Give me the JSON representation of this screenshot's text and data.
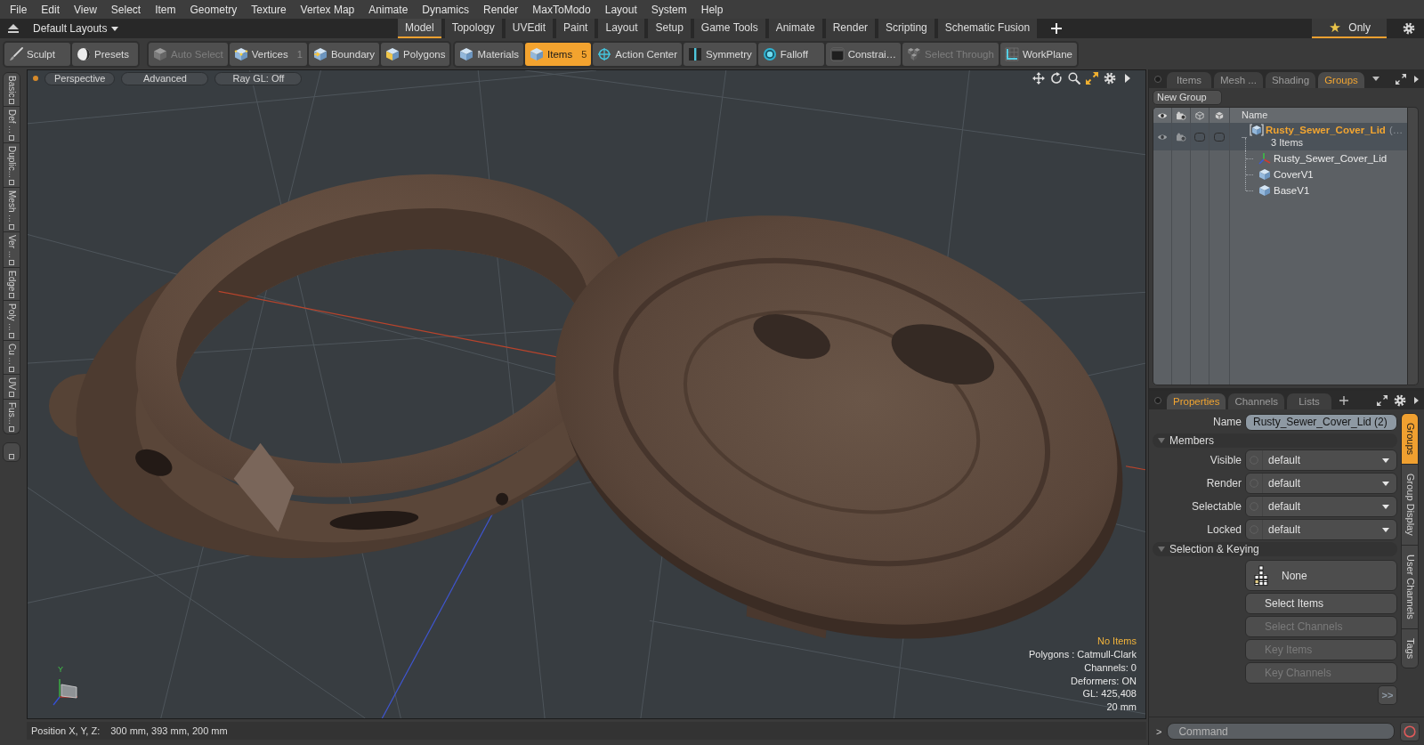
{
  "menu_bar": [
    "File",
    "Edit",
    "View",
    "Select",
    "Item",
    "Geometry",
    "Texture",
    "Vertex Map",
    "Animate",
    "Dynamics",
    "Render",
    "MaxToModo",
    "Layout",
    "System",
    "Help"
  ],
  "layout_bar": {
    "layout_menu": "Default Layouts",
    "tabs": [
      {
        "label": "Model",
        "selected": true
      },
      {
        "label": "Topology",
        "selected": false
      },
      {
        "label": "UVEdit",
        "selected": false
      },
      {
        "label": "Paint",
        "selected": false
      },
      {
        "label": "Layout",
        "selected": false
      },
      {
        "label": "Setup",
        "selected": false
      },
      {
        "label": "Game Tools",
        "selected": false
      },
      {
        "label": "Animate",
        "selected": false
      },
      {
        "label": "Render",
        "selected": false
      },
      {
        "label": "Scripting",
        "selected": false
      },
      {
        "label": "Schematic Fusion",
        "selected": false
      }
    ],
    "only_button": {
      "label": "Only",
      "on": true
    }
  },
  "toolbar": [
    {
      "items": [
        {
          "label": "Sculpt",
          "selected": false,
          "disabled": false
        },
        {
          "label": "Presets",
          "selected": false,
          "disabled": false
        }
      ]
    },
    {
      "items": [
        {
          "label": "Auto Select",
          "selected": false,
          "disabled": true
        },
        {
          "label": "Vertices",
          "count": "1",
          "selected": false,
          "disabled": false
        },
        {
          "label": "Boundary",
          "selected": false,
          "disabled": false
        },
        {
          "label": "Polygons",
          "selected": false,
          "disabled": false
        }
      ]
    },
    {
      "items": [
        {
          "label": "Materials",
          "selected": false,
          "disabled": false
        },
        {
          "label": "Items",
          "count": "5",
          "selected": true,
          "disabled": false
        },
        {
          "label": "Action Center",
          "selected": false,
          "disabled": false
        },
        {
          "label": "Symmetry",
          "selected": false,
          "disabled": false
        },
        {
          "label": "Falloff",
          "selected": false,
          "disabled": false
        },
        {
          "label": "Constrai…",
          "selected": false,
          "disabled": false
        },
        {
          "label": "Select Through",
          "selected": false,
          "disabled": true
        },
        {
          "label": "WorkPlane",
          "selected": false,
          "disabled": false
        }
      ]
    }
  ],
  "tool_tabs": [
    {
      "label": "Basic",
      "selected": false
    },
    {
      "label": "Def ...",
      "selected": false
    },
    {
      "label": "Duplic...",
      "selected": false
    },
    {
      "label": "Mesh ...",
      "selected": false
    },
    {
      "label": "Ver ...",
      "selected": false
    },
    {
      "label": "Edge",
      "selected": false
    },
    {
      "label": "Poly ...",
      "selected": false
    },
    {
      "label": "Cu ...",
      "selected": false
    },
    {
      "label": "UV",
      "selected": false
    },
    {
      "label": "Fus...",
      "selected": false
    }
  ],
  "viewport": {
    "buttons": [
      "Perspective",
      "Advanced",
      "Ray GL: Off"
    ],
    "axis_label": "Y",
    "selection_status": "No Items",
    "info": [
      "Polygons : Catmull-Clark",
      "Channels: 0",
      "Deformers: ON",
      "GL: 425,408",
      "20 mm"
    ]
  },
  "status_bar": {
    "label": "Position X, Y, Z:",
    "value": "300 mm, 393 mm, 200 mm"
  },
  "groups_panel": {
    "tabs": [
      {
        "label": "Items",
        "selected": false
      },
      {
        "label": "Mesh ...",
        "selected": false
      },
      {
        "label": "Shading",
        "selected": false
      },
      {
        "label": "Groups",
        "selected": true
      }
    ],
    "new_group": "New Group",
    "column": "Name",
    "groups": [
      {
        "name": "Rusty_Sewer_Cover_Lid",
        "name_overflow": "(…",
        "count": "3 Items",
        "selected": true,
        "expanded": true,
        "children": [
          {
            "name": "Rusty_Sewer_Cover_Lid",
            "kind": "locator",
            "selected": false
          },
          {
            "name": "CoverV1",
            "kind": "mesh",
            "selected": false
          },
          {
            "name": "BaseV1",
            "kind": "mesh",
            "selected": false
          }
        ]
      }
    ]
  },
  "properties_panel": {
    "tabs": [
      {
        "label": "Properties",
        "selected": true
      },
      {
        "label": "Channels",
        "selected": false
      },
      {
        "label": "Lists",
        "selected": false
      }
    ],
    "name_label": "Name",
    "name_value": "Rusty_Sewer_Cover_Lid (2)",
    "sections": [
      {
        "title": "Members",
        "kind": "fields",
        "expanded": true,
        "fields": [
          {
            "label": "Visible",
            "value": "default"
          },
          {
            "label": "Render",
            "value": "default"
          },
          {
            "label": "Selectable",
            "value": "default"
          },
          {
            "label": "Locked",
            "value": "default"
          }
        ]
      },
      {
        "title": "Selection & Keying",
        "kind": "actions",
        "expanded": true,
        "mode": "None",
        "buttons": [
          {
            "label": "Select Items",
            "disabled": false
          },
          {
            "label": "Select Channels",
            "disabled": true
          },
          {
            "label": "Key Items",
            "disabled": true
          },
          {
            "label": "Key Channels",
            "disabled": true
          }
        ]
      }
    ],
    "more_button": ">>",
    "side_tabs": [
      {
        "label": "Groups",
        "selected": true
      },
      {
        "label": "Group Display",
        "selected": false
      },
      {
        "label": "User Channels",
        "selected": false
      },
      {
        "label": "Tags",
        "selected": false
      }
    ]
  },
  "command_bar": {
    "prompt": ">",
    "placeholder": "Command"
  }
}
